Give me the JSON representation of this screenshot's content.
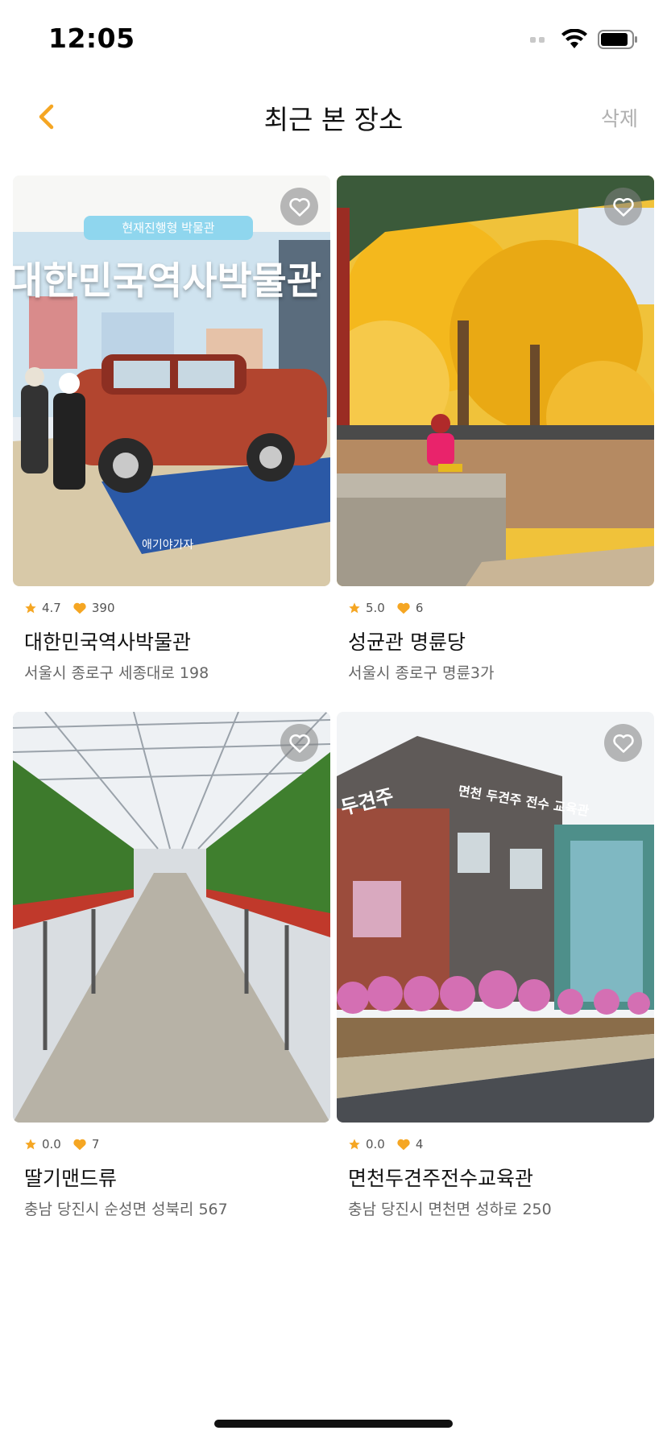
{
  "status_bar": {
    "time": "12:05"
  },
  "nav": {
    "title": "최근 본 장소",
    "delete_label": "삭제"
  },
  "colors": {
    "accent": "#F5A623",
    "muted": "#B0B0B0"
  },
  "places": [
    {
      "name": "대한민국역사박물관",
      "address": "서울시 종로구 세종대로 198",
      "rating": "4.7",
      "likes": "390",
      "photo_text": {
        "banner": "현재진행형 박물관",
        "headline": "대한민국역사박물관",
        "watermark": "애기야가자"
      }
    },
    {
      "name": "성균관 명륜당",
      "address": "서울시 종로구 명륜3가",
      "rating": "5.0",
      "likes": "6"
    },
    {
      "name": "딸기맨드류",
      "address": "충남 당진시 순성면 성북리 567",
      "rating": "0.0",
      "likes": "7"
    },
    {
      "name": "면천두견주전수교육관",
      "address": "충남 당진시 면천면 성하로 250",
      "rating": "0.0",
      "likes": "4",
      "photo_text": {
        "sign_top": "두견주",
        "sign_side": "면천 두견주 전수 교육관"
      }
    }
  ]
}
